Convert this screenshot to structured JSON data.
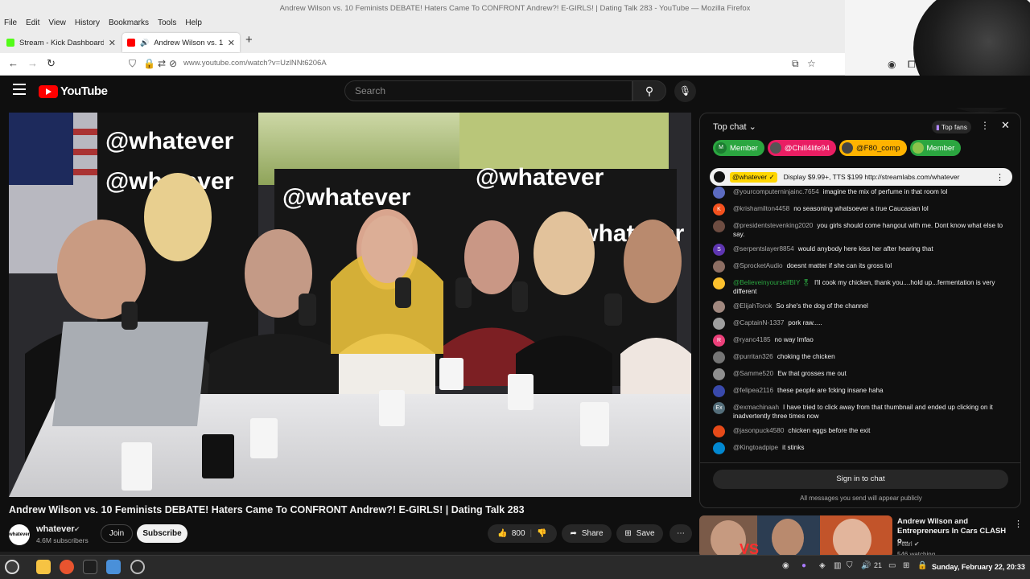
{
  "window": {
    "title": "Andrew Wilson vs. 10 Feminists DEBATE! Haters Came To CONFRONT Andrew?! E-GIRLS! | Dating Talk 283 - YouTube — Mozilla Firefox"
  },
  "menu": [
    "File",
    "Edit",
    "View",
    "History",
    "Bookmarks",
    "Tools",
    "Help"
  ],
  "tabs": [
    {
      "title": "Stream - Kick Dashboard",
      "favicon_color": "#53fc18",
      "close": "✕"
    },
    {
      "title": "Andrew Wilson vs. 10 Fe",
      "favicon_color": "#ff0000",
      "close": "✕"
    }
  ],
  "new_tab": "+",
  "address_bar": {
    "url": "www.youtube.com/watch?v=UzlNNt6206A"
  },
  "youtube": {
    "logo_text": "YouTube",
    "search_placeholder": "Search"
  },
  "video": {
    "title": "Andrew Wilson vs. 10 Feminists DEBATE! Haters Came To CONFRONT Andrew?! E-GIRLS! | Dating Talk 283",
    "channel_name": "whatever",
    "channel_avatar_text": "whatever",
    "verified": "✔",
    "subscribers": "4.6M subscribers",
    "join_label": "Join",
    "subscribe_label": "Subscribe",
    "like_count": "800",
    "share_label": "Share",
    "save_label": "Save",
    "more": "⋯"
  },
  "chat": {
    "header": "Top chat",
    "top_fans_label": "Top fans",
    "chips": [
      {
        "label": "Member",
        "avatar": "M",
        "color": "#2ba640"
      },
      {
        "label": "@Chill4life94",
        "avatar": "",
        "color": "#e91e63"
      },
      {
        "label": "@F80_comp",
        "avatar": "",
        "color": "#ffb300"
      },
      {
        "label": "Member",
        "avatar": "",
        "color": "#2ba640"
      }
    ],
    "pinned": {
      "author": "@whatever ✓",
      "text": "Display $9.99+, TTS $199 http://streamlabs.com/whatever"
    },
    "messages": [
      {
        "author": "@yourcomputerninjainc.7654",
        "text": "imagine the mix of perfume in that room lol",
        "avatar": "",
        "color": "#5c6bc0"
      },
      {
        "author": "@krishamilton4458",
        "text": "no seasoning whatsoever a true Caucasian lol",
        "avatar": "K",
        "color": "#f4511e"
      },
      {
        "author": "@presidentstevenking2020",
        "text": "you girls should come hangout with me. Dont know what else to say.",
        "avatar": "",
        "color": "#6d4c41"
      },
      {
        "author": "@serpentslayer8854",
        "text": "would anybody here kiss her after hearing that",
        "avatar": "S",
        "color": "#5e35b1"
      },
      {
        "author": "@SprocketAudio",
        "text": "doesnt matter if she can its gross lol",
        "avatar": "",
        "color": "#8d6e63"
      },
      {
        "author": "@BelieveinyourselfBIY 🎖",
        "text": "I'll cook my chicken, thank you....hold up...fermentation is very different",
        "avatar": "",
        "color": "#fbc02d",
        "author_color": "#2ba640"
      },
      {
        "author": "@ElijahTorok",
        "text": "So she's the dog of the channel",
        "avatar": "",
        "color": "#a1887f"
      },
      {
        "author": "@CaptainN-1337",
        "text": "pork raw.....",
        "avatar": "",
        "color": "#9e9e9e"
      },
      {
        "author": "@ryanc4185",
        "text": "no way lmfao",
        "avatar": "R",
        "color": "#ec407a"
      },
      {
        "author": "@purritan326",
        "text": "choking the chicken",
        "avatar": "",
        "color": "#757575"
      },
      {
        "author": "@Samme520",
        "text": "Ew that grosses me out",
        "avatar": "",
        "color": "#8e8e8e"
      },
      {
        "author": "@felipea2116",
        "text": "these people are fcking insane haha",
        "avatar": "",
        "color": "#3949ab"
      },
      {
        "author": "@exmachinaah",
        "text": "I have tried to click away from that thumbnail and ended up clicking on it inadvertently three times now",
        "avatar": "Ex",
        "color": "#546e7a"
      },
      {
        "author": "@jasonpuck4580",
        "text": "chicken eggs before the exit",
        "avatar": "",
        "color": "#e64a19"
      },
      {
        "author": "@Kingtoadpipe",
        "text": "it stinks",
        "avatar": "",
        "color": "#0288d1"
      }
    ],
    "signin_label": "Sign in to chat",
    "public_notice": "All messages you send will appear publicly"
  },
  "recommendation": {
    "title": "Andrew Wilson and Entrepreneurs In Cars CLASH o...",
    "channel": "Pearl",
    "watching": "546 watching",
    "thumb_text": "VS"
  },
  "taskbar": {
    "tray_count": "21",
    "clock": "Sunday, February 22, 20:33"
  }
}
